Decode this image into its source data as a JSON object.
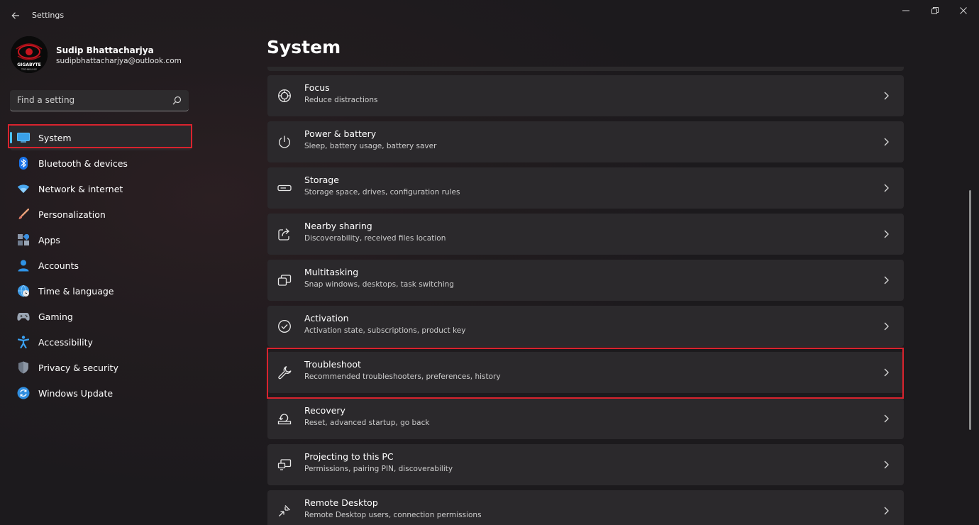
{
  "app": {
    "title": "Settings"
  },
  "user": {
    "name": "Sudip Bhattacharjya",
    "email": "sudipbhattacharjya@outlook.com",
    "avatar_text": "GIGABYTE"
  },
  "search": {
    "placeholder": "Find a setting"
  },
  "nav": {
    "items": [
      {
        "label": "System",
        "icon": "monitor-icon",
        "selected": true
      },
      {
        "label": "Bluetooth & devices",
        "icon": "bluetooth-icon"
      },
      {
        "label": "Network & internet",
        "icon": "wifi-icon"
      },
      {
        "label": "Personalization",
        "icon": "brush-icon"
      },
      {
        "label": "Apps",
        "icon": "apps-icon"
      },
      {
        "label": "Accounts",
        "icon": "person-icon"
      },
      {
        "label": "Time & language",
        "icon": "globe-clock-icon"
      },
      {
        "label": "Gaming",
        "icon": "gamepad-icon"
      },
      {
        "label": "Accessibility",
        "icon": "accessibility-icon"
      },
      {
        "label": "Privacy & security",
        "icon": "shield-icon"
      },
      {
        "label": "Windows Update",
        "icon": "update-icon"
      }
    ]
  },
  "main": {
    "title": "System",
    "items": [
      {
        "title": "Focus",
        "subtitle": "Reduce distractions",
        "icon": "focus-icon"
      },
      {
        "title": "Power & battery",
        "subtitle": "Sleep, battery usage, battery saver",
        "icon": "power-icon"
      },
      {
        "title": "Storage",
        "subtitle": "Storage space, drives, configuration rules",
        "icon": "storage-icon"
      },
      {
        "title": "Nearby sharing",
        "subtitle": "Discoverability, received files location",
        "icon": "share-icon"
      },
      {
        "title": "Multitasking",
        "subtitle": "Snap windows, desktops, task switching",
        "icon": "multitasking-icon"
      },
      {
        "title": "Activation",
        "subtitle": "Activation state, subscriptions, product key",
        "icon": "check-circle-icon"
      },
      {
        "title": "Troubleshoot",
        "subtitle": "Recommended troubleshooters, preferences, history",
        "icon": "wrench-icon"
      },
      {
        "title": "Recovery",
        "subtitle": "Reset, advanced startup, go back",
        "icon": "recovery-icon"
      },
      {
        "title": "Projecting to this PC",
        "subtitle": "Permissions, pairing PIN, discoverability",
        "icon": "projecting-icon"
      },
      {
        "title": "Remote Desktop",
        "subtitle": "Remote Desktop users, connection permissions",
        "icon": "remote-desktop-icon"
      }
    ]
  },
  "colors": {
    "accent": "#4cc2ff",
    "highlight": "#d9232e"
  }
}
